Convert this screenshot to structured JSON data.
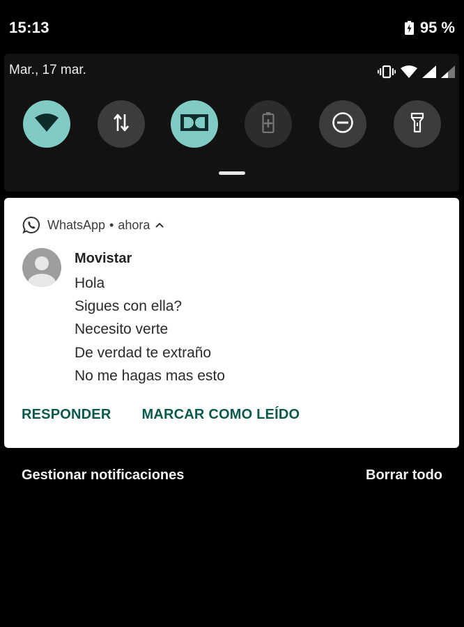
{
  "status_bar": {
    "time": "15:13",
    "battery_percent": "95 %"
  },
  "quick_settings": {
    "date": "Mar., 17 mar.",
    "system_icons": [
      "vibrate-icon",
      "wifi-signal-icon",
      "cell-signal-icon",
      "cell-signal-weak-icon"
    ],
    "tiles": [
      {
        "icon": "wifi-icon",
        "state": "on"
      },
      {
        "icon": "mobile-data-icon",
        "state": "off"
      },
      {
        "icon": "dolby-icon",
        "state": "on"
      },
      {
        "icon": "battery-saver-icon",
        "state": "disabled"
      },
      {
        "icon": "do-not-disturb-icon",
        "state": "off"
      },
      {
        "icon": "flashlight-icon",
        "state": "off"
      }
    ],
    "colors": {
      "active": "#80cbc4",
      "inactive": "#3c3c3c"
    }
  },
  "notification": {
    "app_name": "WhatsApp",
    "separator": "•",
    "time": "ahora",
    "expand_icon": "chevron-up-icon",
    "sender": "Movistar",
    "messages": [
      "Hola",
      "Sigues con ella?",
      "Necesito verte",
      "De verdad te extraño",
      "No me hagas mas esto"
    ],
    "actions": [
      "RESPONDER",
      "MARCAR COMO LEÍDO"
    ],
    "accent_color": "#0a5a4c"
  },
  "footer": {
    "manage_label": "Gestionar notificaciones",
    "clear_label": "Borrar todo"
  }
}
